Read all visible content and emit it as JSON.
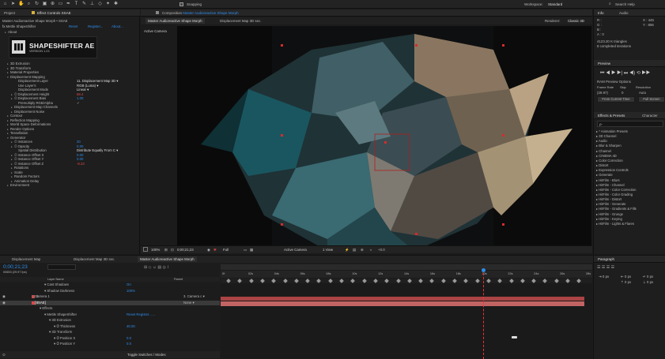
{
  "topbar": {
    "snapping": "Snapping",
    "workspace_label": "Workspace:",
    "workspace_value": "Standard",
    "search_placeholder": "Search Help"
  },
  "left_panel": {
    "tabs": {
      "project": "Project",
      "effect_controls": "Effect Controls SSAE"
    },
    "comp_path": "Master Audioreactive Shape Morph • SSAE",
    "effect_name": "Mettle ShapeShifter",
    "reset": "Reset",
    "register": "Register...",
    "about": "About...",
    "about_row": "About",
    "logo_title": "SHAPESHIFTER AE",
    "logo_version": "VERSION 1.23",
    "rows": [
      {
        "label": "3D Extrusion",
        "indent": 1,
        "arrow": "▸"
      },
      {
        "label": "3D Transform",
        "indent": 1,
        "arrow": "▸"
      },
      {
        "label": "Material Properties",
        "indent": 1,
        "arrow": "▸"
      },
      {
        "label": "Displacement Mapping",
        "indent": 1,
        "arrow": "▾"
      },
      {
        "label": "Displacement Layer",
        "indent": 3,
        "arrow": "",
        "value": "11. Displacement Map 3D",
        "vclass": "",
        "dropdown": true,
        "vx": 97
      },
      {
        "label": "Use Layer's",
        "indent": 3,
        "arrow": "",
        "value": "RGB (Luma)",
        "vclass": "",
        "dropdown": true,
        "vx": 97
      },
      {
        "label": "Displacement Mode",
        "indent": 3,
        "arrow": "",
        "value": "Linear",
        "vclass": "",
        "dropdown": true,
        "vx": 97
      },
      {
        "label": "Displacement Height",
        "indent": 2,
        "arrow": "▸",
        "sw": true,
        "value": "68.4",
        "vclass": "red",
        "vx": 97
      },
      {
        "label": "Displacement Bias",
        "indent": 2,
        "arrow": "▸",
        "sw": true,
        "value": "1.00",
        "vclass": "blue",
        "vx": 97
      },
      {
        "label": "Premultiply RGB/Alpha",
        "indent": 3,
        "arrow": "",
        "value": "✓",
        "vclass": "",
        "vx": 97
      },
      {
        "label": "Displacement Map Channels",
        "indent": 2,
        "arrow": "▸"
      },
      {
        "label": "Displacement Noise",
        "indent": 2,
        "arrow": "▸"
      },
      {
        "label": "Contour",
        "indent": 1,
        "arrow": "▸"
      },
      {
        "label": "Reflection Mapping",
        "indent": 1,
        "arrow": "▸"
      },
      {
        "label": "World Space Deformations",
        "indent": 1,
        "arrow": "▸"
      },
      {
        "label": "Render Options",
        "indent": 1,
        "arrow": "▸"
      },
      {
        "label": "Tessellation",
        "indent": 1,
        "arrow": "▸"
      },
      {
        "label": "Generator",
        "indent": 1,
        "arrow": "▾"
      },
      {
        "label": "Instances",
        "indent": 2,
        "arrow": "▸",
        "sw": true,
        "value": "20",
        "vclass": "blue",
        "vx": 97
      },
      {
        "label": "Opacity",
        "indent": 2,
        "arrow": "▸",
        "sw": true,
        "value": "0.00",
        "vclass": "blue",
        "vx": 97
      },
      {
        "label": "Spatial Distribution",
        "indent": 3,
        "arrow": "",
        "value": "Distribute Equally From C",
        "vclass": "",
        "dropdown": true,
        "vx": 97
      },
      {
        "label": "Instance Offset X",
        "indent": 2,
        "arrow": "▸",
        "sw": true,
        "value": "0.00",
        "vclass": "blue",
        "vx": 97
      },
      {
        "label": "Instance Offset Y",
        "indent": 2,
        "arrow": "▸",
        "sw": true,
        "value": "0.00",
        "vclass": "blue",
        "vx": 97
      },
      {
        "label": "Instance Offset Z",
        "indent": 2,
        "arrow": "▸",
        "sw": true,
        "value": "-8.23",
        "vclass": "red",
        "vx": 97
      },
      {
        "label": "Rotations",
        "indent": 2,
        "arrow": "▸"
      },
      {
        "label": "Scale",
        "indent": 2,
        "arrow": "▸"
      },
      {
        "label": "Random Factors",
        "indent": 2,
        "arrow": "▸"
      },
      {
        "label": "Animation Delay",
        "indent": 2,
        "arrow": "▸"
      },
      {
        "label": "Environment",
        "indent": 1,
        "arrow": "▸"
      }
    ]
  },
  "viewer": {
    "tab_prefix": "Composition",
    "comp_title": "Master Audioreactive Shape Morph",
    "tab_active": "Master Audioreactive Shape Morph",
    "tab_other": "Displacement Map 3D sec.",
    "camera": "Active Camera",
    "renderer_label": "Renderer:",
    "renderer_value": "Classic 3D",
    "bottom": {
      "zoom": "100%",
      "timecode": "0;00;21;23",
      "quality": "Full",
      "view_camera": "Active Camera",
      "views": "1 View",
      "exposure": "+0.0"
    }
  },
  "info_panel": {
    "tabs": {
      "info": "Info",
      "audio": "Audio"
    },
    "r": "R :",
    "g": "G :",
    "b": "B :",
    "a": "A :  0",
    "x": "X : 445",
    "y": "Y : 856",
    "line1": "4123.20 K triangles",
    "line2": "8 completed iterations"
  },
  "preview_panel": {
    "tab": "Preview",
    "ram_options": "RAM Preview Options",
    "frame_rate_label": "Frame Rate",
    "skip_label": "Skip",
    "resolution_label": "Resolution",
    "frame_rate": "(29.97)",
    "skip": "0",
    "resolution": "Auto",
    "from_current": "From Current Time",
    "full_screen": "Full Screen"
  },
  "effects_panel": {
    "tabs": {
      "effects": "Effects & Presets",
      "character": "Character"
    },
    "search_placeholder": "ρ-",
    "items": [
      "* Animation Presets",
      "3D Channel",
      "Audio",
      "Blur & Sharpen",
      "Channel",
      "CINEMA 4D",
      "Color Correction",
      "Distort",
      "Expression Controls",
      "Generate",
      "HitFilm - Blurs",
      "HitFilm - Channel",
      "HitFilm - Color Correction",
      "HitFilm - Color Grading",
      "HitFilm - Distort",
      "HitFilm - Generate",
      "HitFilm - Gradients & Fills",
      "HitFilm - Grunge",
      "HitFilm - Keying",
      "HitFilm - Lights & Flares"
    ]
  },
  "paragraph_panel": {
    "tab": "Paragraph",
    "px1": "0 px",
    "px2": "0 px",
    "px3": "0 px",
    "px4": "0 px",
    "px5": "0 px"
  },
  "timeline": {
    "tabs": [
      {
        "label": "Displacement Map",
        "active": false
      },
      {
        "label": "Displacement Map 3D sec.",
        "active": false
      },
      {
        "label": "Master Audioreactive Shape Morph",
        "active": true
      }
    ],
    "timecode": "0;00;21;23",
    "fps": "00653 (29.97 fps)",
    "col_layer": "Layer Name",
    "col_parent": "Parent",
    "rulers": [
      "0f",
      "02s",
      "04s",
      "06s",
      "08s",
      "10s",
      "12s",
      "14s",
      "16s",
      "18s",
      "20s",
      "22s",
      "24s",
      "26s",
      "28s"
    ],
    "rows": [
      {
        "label": "Cast Shadows",
        "indent": 3,
        "value": "On",
        "vclass": "blue"
      },
      {
        "label": "Shadow Darkness",
        "indent": 3,
        "value": "100%",
        "vclass": "blue"
      },
      {
        "label": "Camera 1",
        "indent": 1,
        "num": "6",
        "parent": "3. Camera c",
        "type": "cam"
      },
      {
        "label": "[SSAE]",
        "indent": 1,
        "num": "7",
        "parent": "None",
        "type": "sel"
      },
      {
        "label": "Effects",
        "indent": 2
      },
      {
        "label": "Mettle ShapeShifter",
        "indent": 3,
        "value": "Reset   Register...   ...",
        "vclass": "blue"
      },
      {
        "label": "3D Extrusion",
        "indent": 4
      },
      {
        "label": "Thickness",
        "indent": 5,
        "value": "40.00",
        "vclass": "blue",
        "sw": true
      },
      {
        "label": "3D Transform",
        "indent": 4
      },
      {
        "label": "Position X",
        "indent": 5,
        "value": "0.0",
        "vclass": "blue",
        "sw": true
      },
      {
        "label": "Position Y",
        "indent": 5,
        "value": "0.0",
        "vclass": "blue",
        "sw": true
      }
    ],
    "toggle": "Toggle Switches / Modes"
  }
}
